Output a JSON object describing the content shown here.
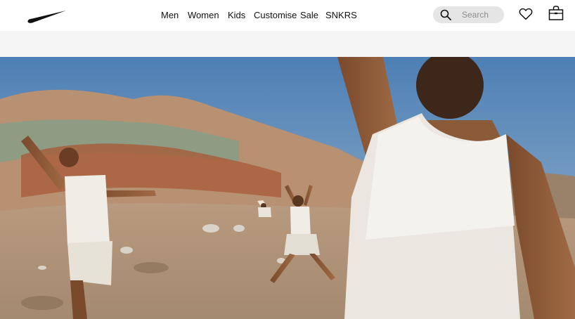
{
  "brand": {
    "logo_icon": "nike-swoosh-icon"
  },
  "nav": {
    "items": [
      {
        "label": "Men"
      },
      {
        "label": "Women"
      },
      {
        "label": "Kids"
      },
      {
        "label": "Customise"
      },
      {
        "label": "Sale"
      },
      {
        "label": "SNKRS"
      }
    ]
  },
  "search": {
    "placeholder": "Search",
    "icon": "search-icon"
  },
  "actions": {
    "favorites_icon": "heart-icon",
    "bag_icon": "bag-icon"
  },
  "hero": {
    "image_description_icon": "hero-image"
  },
  "colors": {
    "text": "#111111",
    "search_bg": "#e5e5e5",
    "banner_bg": "#f5f5f5"
  }
}
